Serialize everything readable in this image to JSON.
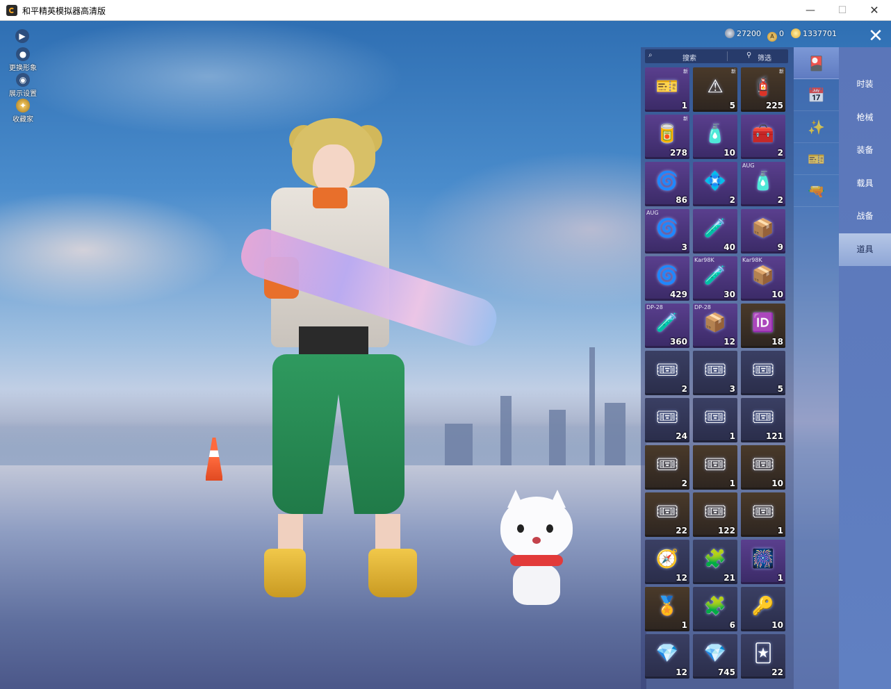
{
  "window": {
    "title": "和平精英模拟器高清版",
    "min_label": "—",
    "max_label": "☐",
    "close_label": "✕"
  },
  "side_controls": {
    "expand_label": "▶",
    "change_look_label": "更换形象",
    "display_settings_label": "展示设置",
    "collection_label": "收藏家"
  },
  "currency": {
    "silver": "27200",
    "token": "0",
    "coins": "1337701"
  },
  "close_panel_label": "✕",
  "inventory": {
    "search_placeholder": "搜索",
    "filter_label": "筛选",
    "items": [
      {
        "glyph": "🎫",
        "qty": "1",
        "tag": "",
        "new": "新",
        "tone": "purple"
      },
      {
        "glyph": "⚠",
        "qty": "5",
        "tag": "",
        "new": "新",
        "tone": "gold"
      },
      {
        "glyph": "🧯",
        "qty": "225",
        "tag": "",
        "new": "新",
        "tone": "gold"
      },
      {
        "glyph": "🥫",
        "qty": "278",
        "tag": "",
        "new": "新",
        "tone": "purple"
      },
      {
        "glyph": "🧴",
        "qty": "10",
        "tag": "",
        "new": "",
        "tone": "purple"
      },
      {
        "glyph": "🧰",
        "qty": "2",
        "tag": "",
        "new": "",
        "tone": "purple"
      },
      {
        "glyph": "🌀",
        "qty": "86",
        "tag": "",
        "new": "",
        "tone": "purple"
      },
      {
        "glyph": "💠",
        "qty": "2",
        "tag": "",
        "new": "",
        "tone": "purple"
      },
      {
        "glyph": "🧴",
        "qty": "2",
        "tag": "AUG",
        "new": "",
        "tone": "purple"
      },
      {
        "glyph": "🌀",
        "qty": "3",
        "tag": "AUG",
        "new": "",
        "tone": "purple"
      },
      {
        "glyph": "🧪",
        "qty": "40",
        "tag": "",
        "new": "",
        "tone": "purple"
      },
      {
        "glyph": "📦",
        "qty": "9",
        "tag": "",
        "new": "",
        "tone": "purple"
      },
      {
        "glyph": "🌀",
        "qty": "429",
        "tag": "",
        "new": "",
        "tone": "purple"
      },
      {
        "glyph": "🧪",
        "qty": "30",
        "tag": "Kar98K",
        "new": "",
        "tone": "purple"
      },
      {
        "glyph": "📦",
        "qty": "10",
        "tag": "Kar98K",
        "new": "",
        "tone": "purple"
      },
      {
        "glyph": "🧪",
        "qty": "360",
        "tag": "DP-28",
        "new": "",
        "tone": "purple"
      },
      {
        "glyph": "📦",
        "qty": "12",
        "tag": "DP-28",
        "new": "",
        "tone": "purple"
      },
      {
        "glyph": "🆔",
        "qty": "18",
        "tag": "",
        "new": "",
        "tone": "gold"
      },
      {
        "glyph": "🎟",
        "qty": "2",
        "tag": "",
        "new": "",
        "tone": ""
      },
      {
        "glyph": "🎟",
        "qty": "3",
        "tag": "",
        "new": "",
        "tone": ""
      },
      {
        "glyph": "🎟",
        "qty": "5",
        "tag": "",
        "new": "",
        "tone": ""
      },
      {
        "glyph": "🎟",
        "qty": "24",
        "tag": "",
        "new": "",
        "tone": ""
      },
      {
        "glyph": "🎟",
        "qty": "1",
        "tag": "",
        "new": "",
        "tone": ""
      },
      {
        "glyph": "🎟",
        "qty": "121",
        "tag": "",
        "new": "",
        "tone": ""
      },
      {
        "glyph": "🎟",
        "qty": "2",
        "tag": "",
        "new": "",
        "tone": "gold"
      },
      {
        "glyph": "🎟",
        "qty": "1",
        "tag": "",
        "new": "",
        "tone": "gold"
      },
      {
        "glyph": "🎟",
        "qty": "10",
        "tag": "",
        "new": "",
        "tone": "gold"
      },
      {
        "glyph": "🎟",
        "qty": "22",
        "tag": "",
        "new": "",
        "tone": "gold"
      },
      {
        "glyph": "🎟",
        "qty": "122",
        "tag": "",
        "new": "",
        "tone": "gold"
      },
      {
        "glyph": "🎟",
        "qty": "1",
        "tag": "",
        "new": "",
        "tone": "gold"
      },
      {
        "glyph": "🧭",
        "qty": "12",
        "tag": "",
        "new": "",
        "tone": ""
      },
      {
        "glyph": "🧩",
        "qty": "21",
        "tag": "",
        "new": "",
        "tone": ""
      },
      {
        "glyph": "🎆",
        "qty": "1",
        "tag": "",
        "new": "",
        "tone": "purple"
      },
      {
        "glyph": "🏅",
        "qty": "1",
        "tag": "",
        "new": "",
        "tone": "gold"
      },
      {
        "glyph": "🧩",
        "qty": "6",
        "tag": "",
        "new": "",
        "tone": ""
      },
      {
        "glyph": "🔑",
        "qty": "10",
        "tag": "",
        "new": "",
        "tone": ""
      },
      {
        "glyph": "💎",
        "qty": "12",
        "tag": "",
        "new": "",
        "tone": ""
      },
      {
        "glyph": "💎",
        "qty": "745",
        "tag": "",
        "new": "",
        "tone": ""
      },
      {
        "glyph": "🃏",
        "qty": "22",
        "tag": "",
        "new": "",
        "tone": ""
      }
    ]
  },
  "category_tabs": [
    {
      "icon": "card-icon",
      "glyph": "🎴",
      "active": true
    },
    {
      "icon": "calendar-icon",
      "glyph": "📅",
      "active": false
    },
    {
      "icon": "firework-icon",
      "glyph": "✨",
      "active": false
    },
    {
      "icon": "ticket-icon",
      "glyph": "🎫",
      "active": false
    },
    {
      "icon": "rifle-icon",
      "glyph": "🔫",
      "active": false
    }
  ],
  "menu": [
    {
      "label": "时装",
      "active": false
    },
    {
      "label": "枪械",
      "active": false
    },
    {
      "label": "装备",
      "active": false
    },
    {
      "label": "载具",
      "active": false
    },
    {
      "label": "战备",
      "active": false
    },
    {
      "label": "道具",
      "active": true
    }
  ]
}
